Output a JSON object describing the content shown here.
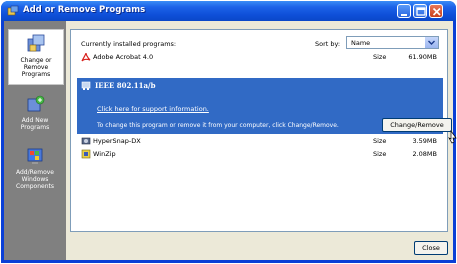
{
  "window": {
    "title": "Add or Remove Programs"
  },
  "sidebar": {
    "items": [
      {
        "label": "Change or\nRemove\nPrograms",
        "icon": "change-remove-programs-icon",
        "selected": true
      },
      {
        "label": "Add New\nPrograms",
        "icon": "add-new-programs-icon",
        "selected": false
      },
      {
        "label": "Add/Remove\nWindows\nComponents",
        "icon": "windows-components-icon",
        "selected": false
      }
    ]
  },
  "header": {
    "installed_label": "Currently installed programs:",
    "sort_label": "Sort by:",
    "sort_value": "Name"
  },
  "programs": [
    {
      "name": "Adobe Acrobat 4.0",
      "size_label": "Size",
      "size": "61.90MB",
      "icon": "acrobat-icon"
    },
    {
      "name": "IEEE 802.11a/b",
      "icon": "network-card-icon",
      "selected": true,
      "support_link": "Click here for support information.",
      "help_text": "To change this program or remove it from your computer, click Change/Remove.",
      "button": "Change/Remove"
    },
    {
      "name": "HyperSnap-DX",
      "size_label": "Size",
      "size": "3.59MB",
      "icon": "hypersnap-icon"
    },
    {
      "name": "WinZip",
      "size_label": "Size",
      "size": "2.08MB",
      "icon": "winzip-icon"
    }
  ],
  "footer": {
    "close_label": "Close"
  },
  "colors": {
    "titlebar": "#0a47c8",
    "selection": "#316ac5",
    "sidebar": "#808080",
    "client": "#ece9d8"
  }
}
